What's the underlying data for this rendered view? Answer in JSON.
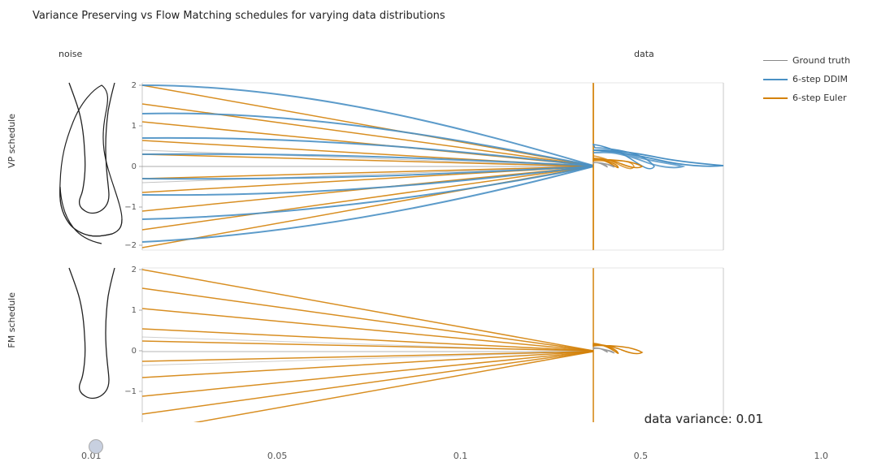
{
  "title": "Variance Preserving vs Flow Matching schedules for varying data distributions",
  "legend": {
    "items": [
      {
        "label": "Ground truth",
        "color": "#888888",
        "width": 1
      },
      {
        "label": "6-step DDIM",
        "color": "#4a90c4",
        "width": 2
      },
      {
        "label": "6-step Euler",
        "color": "#d4820a",
        "width": 2
      }
    ]
  },
  "axes": {
    "noise_label": "noise",
    "data_label": "data",
    "vp_label": "VP schedule",
    "fm_label": "FM schedule"
  },
  "data_variance": "data variance: 0.01",
  "slider": {
    "ticks": [
      "0.01",
      "0.05",
      "0.1",
      "0.5",
      "1.0"
    ],
    "value": "0.01"
  },
  "yticks": [
    "2",
    "1",
    "0",
    "-1",
    "-2"
  ]
}
